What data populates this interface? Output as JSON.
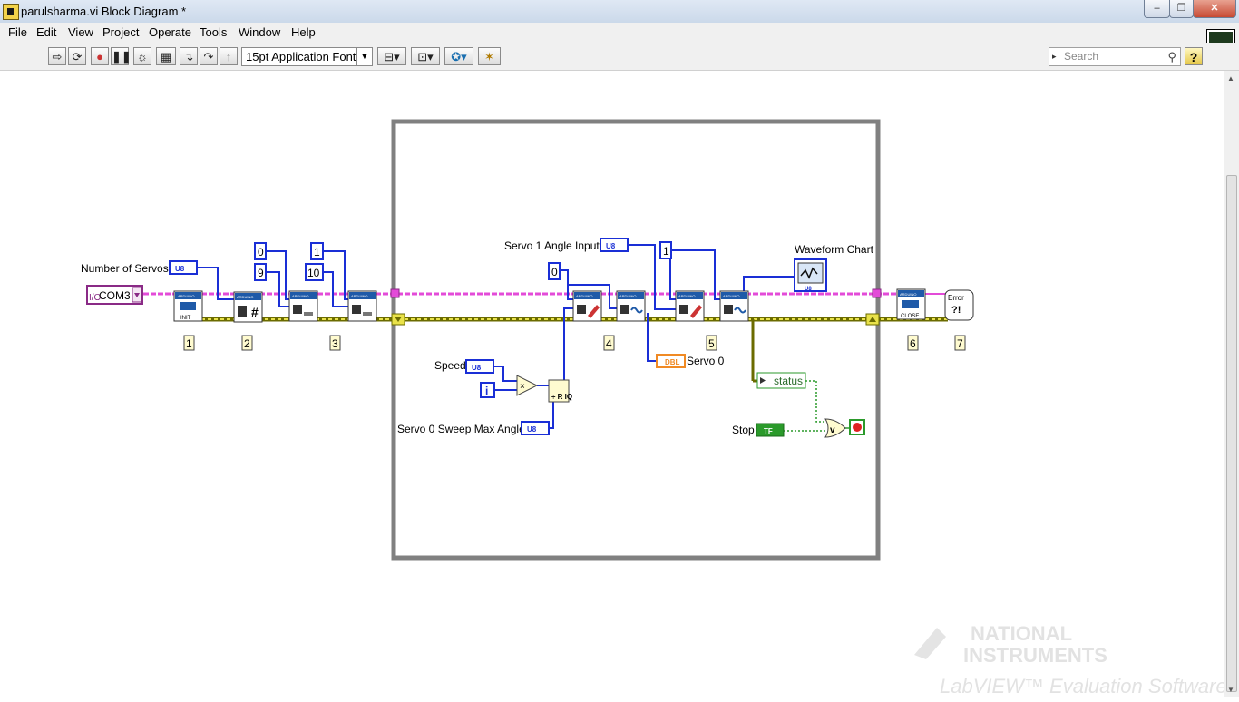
{
  "window": {
    "title": "parulsharma.vi Block Diagram *",
    "buttons": {
      "minimize": "–",
      "restore": "❐",
      "close": "✕"
    }
  },
  "menu": [
    "File",
    "Edit",
    "View",
    "Project",
    "Operate",
    "Tools",
    "Window",
    "Help"
  ],
  "toolbar": {
    "font_selector": "15pt Application Font",
    "search_placeholder": "Search",
    "help": "?"
  },
  "diagram": {
    "labels": {
      "number_of_servos": "Number of Servos",
      "servo1_angle_input": "Servo 1 Angle Input",
      "waveform_chart": "Waveform Chart",
      "speed": "Speed",
      "servo0_sweep_max": "Servo 0 Sweep Max Angle",
      "servo0": "Servo 0",
      "stop": "Stop",
      "status": "status"
    },
    "com_port": "COM3",
    "type_u8": "U8",
    "type_dbl": "DBL",
    "type_tf": "TF",
    "iteration": "i",
    "constants": {
      "zero_a": "0",
      "nine": "9",
      "one_a": "1",
      "ten": "10",
      "zero_b": "0",
      "one_b": "1"
    },
    "block_text": {
      "arduino": "ARDUINO",
      "init": "INIT",
      "close": "CLOSE",
      "error": "Error",
      "err_q": "?!"
    },
    "steps": [
      "1",
      "2",
      "3",
      "4",
      "5",
      "6",
      "7"
    ]
  },
  "watermark": {
    "line1": "NATIONAL",
    "line2": "INSTRUMENTS",
    "line3": "LabVIEW™ Evaluation Software"
  }
}
